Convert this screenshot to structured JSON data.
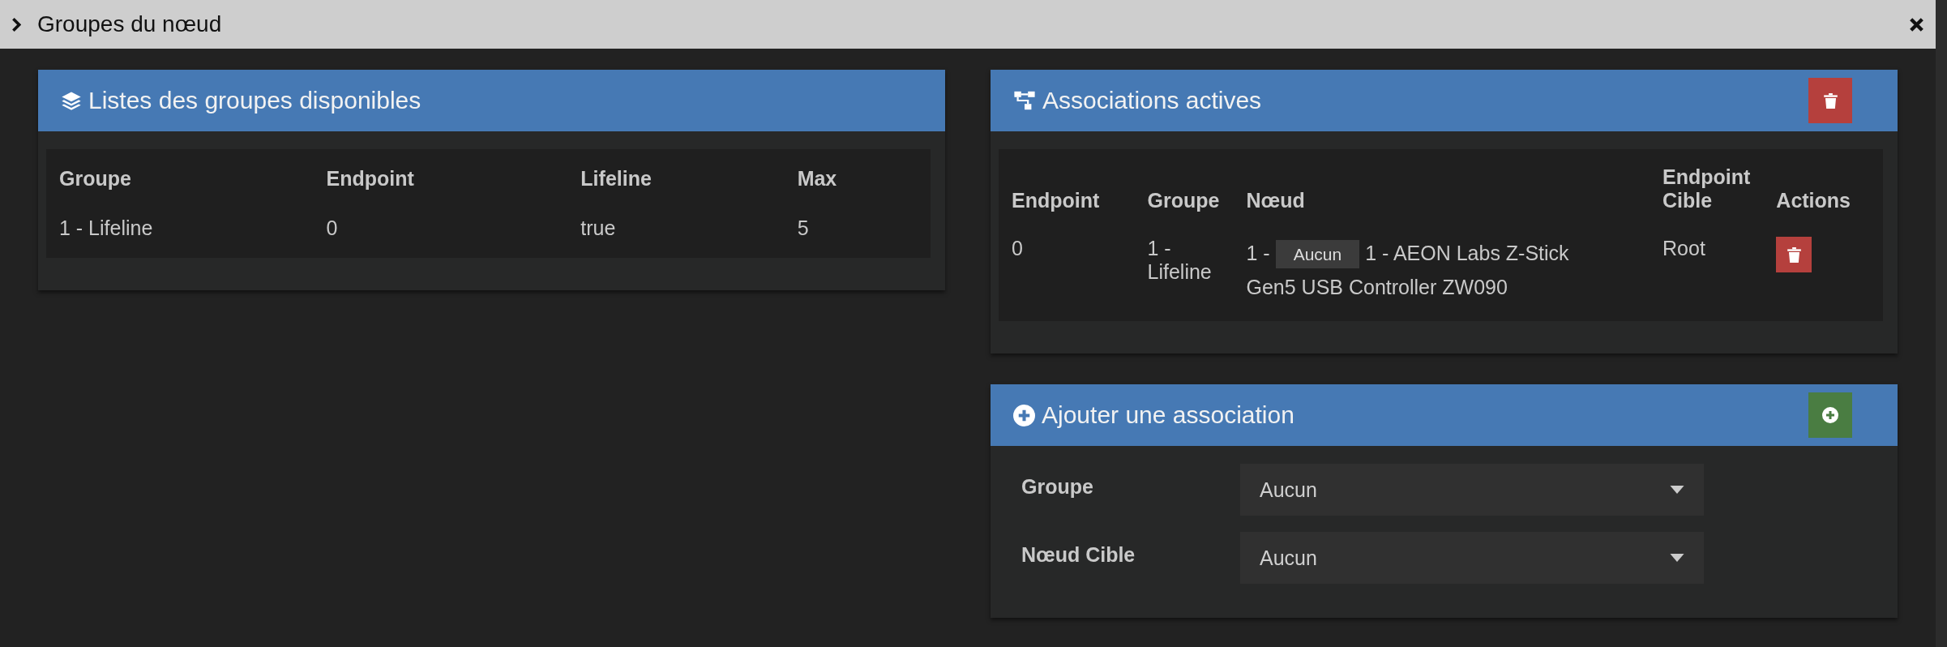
{
  "window": {
    "title": "Groupes du nœud"
  },
  "groups_panel": {
    "title": "Listes des groupes disponibles",
    "table": {
      "columns": [
        "Groupe",
        "Endpoint",
        "Lifeline",
        "Max"
      ],
      "rows": [
        [
          "1 - Lifeline",
          "0",
          "true",
          "5"
        ]
      ]
    }
  },
  "associations_panel": {
    "title": "Associations actives",
    "table": {
      "columns": [
        "Endpoint",
        "Groupe",
        "Nœud",
        "Endpoint Cible",
        "Actions"
      ],
      "rows": [
        {
          "endpoint": "0",
          "group": "1 - Lifeline",
          "node_prefix": "1 -",
          "node_tag": "Aucun",
          "node_name_lines": [
            "1 - AEON Labs Z-Stick",
            "Gen5 USB Controller ZW090"
          ],
          "target_endpoint": "Root"
        }
      ]
    }
  },
  "add_panel": {
    "title": "Ajouter une association",
    "fields": [
      {
        "label": "Groupe",
        "value": "Aucun"
      },
      {
        "label": "Nœud Cible",
        "value": "Aucun"
      }
    ]
  }
}
